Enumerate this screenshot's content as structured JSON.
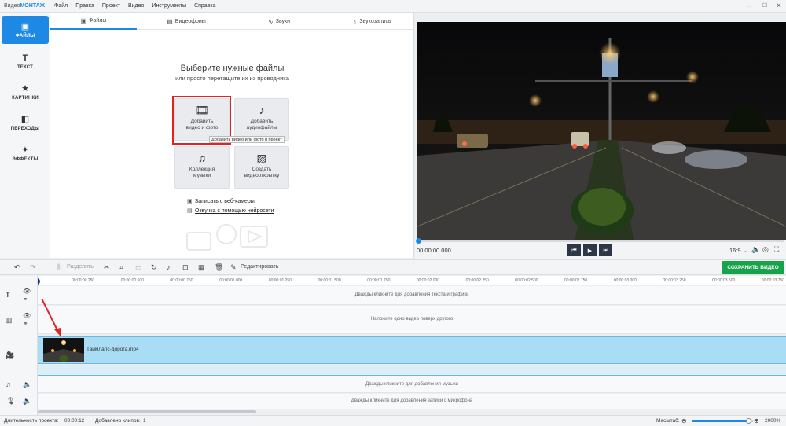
{
  "app": {
    "logo_prefix": "Видео",
    "logo_brand": "МОНТАЖ"
  },
  "menu": [
    "Файл",
    "Правка",
    "Проект",
    "Видео",
    "Инструменты",
    "Справка"
  ],
  "sidebar": [
    {
      "label": "ФАЙЛЫ",
      "icon": "image-icon",
      "active": true
    },
    {
      "label": "ТЕКСТ",
      "icon": "text-icon"
    },
    {
      "label": "КАРТИНКИ",
      "icon": "star-icon"
    },
    {
      "label": "ПЕРЕХОДЫ",
      "icon": "transitions-icon"
    },
    {
      "label": "ЭФФЕКТЫ",
      "icon": "magic-wand-icon"
    }
  ],
  "tabs": [
    {
      "label": "Файлы",
      "active": true
    },
    {
      "label": "Видеофоны"
    },
    {
      "label": "Звуки"
    },
    {
      "label": "Звукозапись"
    }
  ],
  "files_panel": {
    "title": "Выберите нужные файлы",
    "subtitle": "или просто перетащите их из проводника",
    "tiles": [
      {
        "line1": "Добавить",
        "line2": "видео и фото"
      },
      {
        "line1": "Добавить",
        "line2": "аудиофайлы"
      },
      {
        "line1": "Коллекция",
        "line2": "музыки"
      },
      {
        "line1": "Создать",
        "line2": "видеооткрытку"
      }
    ],
    "tooltip": "Добавить видео или фото в проект",
    "links": [
      "Записать с веб-камеры",
      "Озвучка с помощью нейросети"
    ]
  },
  "player": {
    "time": "00:00:00.000",
    "aspect": "16:9 ⌄"
  },
  "toolbar": {
    "split_label": "Разделить",
    "edit_label": "Редактировать",
    "save_label": "СОХРАНИТЬ ВИДЕО"
  },
  "ruler_ticks": [
    "00:00:00.250",
    "00:00:00.500",
    "00:00:00.750",
    "00:00:01.000",
    "00:00:01.250",
    "00:00:01.500",
    "00:00:01.750",
    "00:00:02.000",
    "00:00:02.250",
    "00:00:02.500",
    "00:00:02.750",
    "00:00:03.000",
    "00:00:03.250",
    "00:00:03.500",
    "00:00:03.750"
  ],
  "timeline": {
    "text_hint": "Дважды кликните для добавления текста и графики",
    "overlay_hint": "Наложите одно видео поверх другого",
    "clip_name": "Таймлапс-дорога.mp4",
    "music_hint": "Дважды кликните для добавления музыки",
    "mic_hint": "Дважды кликните для добавления записи с микрофона"
  },
  "status": {
    "duration_label": "Длительность проекта:",
    "duration_value": "00:00:12",
    "clips_label": "Добавлено клипов:",
    "clips_value": "1",
    "zoom_label": "Масштаб:",
    "zoom_value": "2000%",
    "zoom_level": 0.92
  },
  "colors": {
    "accent": "#1e88e5",
    "save": "#17a34a",
    "highlight": "#e02424",
    "clip": "#a9dcf5"
  }
}
